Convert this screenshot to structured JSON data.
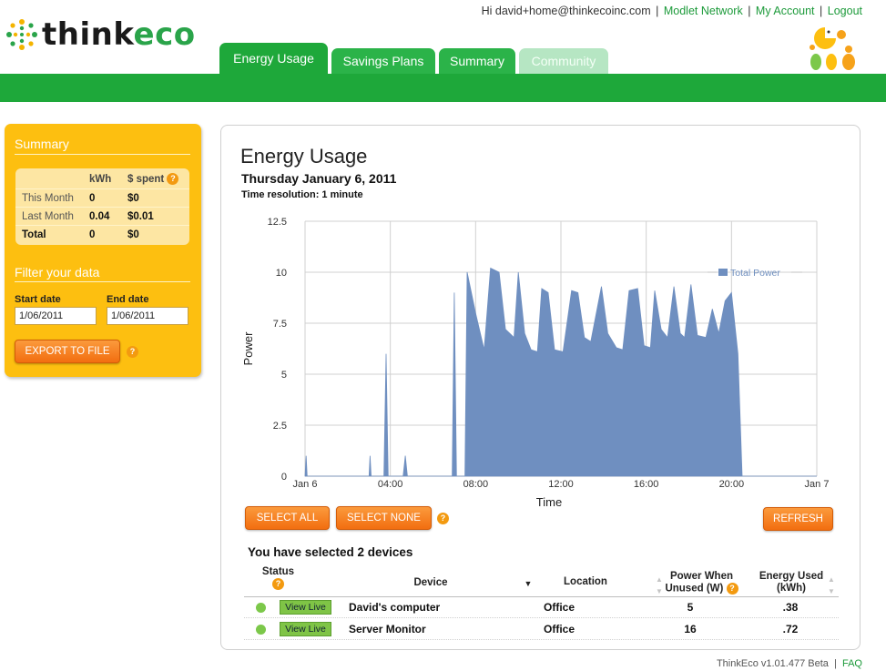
{
  "app": {
    "logo_think": "think",
    "logo_eco": "eco"
  },
  "toplinks": {
    "greeting_prefix": "Hi ",
    "email": "david+home@thinkecoinc.com",
    "separator": "|",
    "modlet_network": "Modlet Network",
    "my_account": "My Account",
    "logout": "Logout"
  },
  "tabs": [
    {
      "label": "Energy Usage",
      "state": "active"
    },
    {
      "label": "Savings Plans",
      "state": "normal"
    },
    {
      "label": "Summary",
      "state": "normal"
    },
    {
      "label": "Community",
      "state": "disabled"
    }
  ],
  "sidebar": {
    "summary_title": "Summary",
    "table": {
      "headers": [
        "",
        "kWh",
        "$ spent"
      ],
      "rows": [
        [
          "This Month",
          "0",
          "$0"
        ],
        [
          "Last Month",
          "0.04",
          "$0.01"
        ],
        [
          "Total",
          "0",
          "$0"
        ]
      ]
    },
    "help_glyph": "?",
    "filter_title": "Filter your data",
    "start_label": "Start date",
    "end_label": "End date",
    "start_value": "1/06/2011",
    "end_value": "1/06/2011",
    "export_label": "EXPORT TO FILE"
  },
  "main": {
    "title": "Energy Usage",
    "date": "Thursday January 6, 2011",
    "resolution": "Time resolution: 1 minute",
    "select_all": "SELECT ALL",
    "select_none": "SELECT NONE",
    "refresh": "REFRESH",
    "selected_text": "You have selected 2 devices"
  },
  "chart_data": {
    "type": "area",
    "xlabel": "Time",
    "ylabel": "Power",
    "ylim": [
      0,
      12.5
    ],
    "yticks": [
      0,
      2.5,
      5,
      7.5,
      10,
      12.5
    ],
    "xlim": [
      0,
      24
    ],
    "xticks": [
      {
        "x": 0,
        "label": "Jan 6"
      },
      {
        "x": 4,
        "label": "04:00"
      },
      {
        "x": 8,
        "label": "08:00"
      },
      {
        "x": 12,
        "label": "12:00"
      },
      {
        "x": 16,
        "label": "16:00"
      },
      {
        "x": 20,
        "label": "20:00"
      },
      {
        "x": 24,
        "label": "Jan 7"
      }
    ],
    "grid": true,
    "legend": "top-right",
    "series": [
      {
        "name": "Total Power",
        "color": "#6f8fc0",
        "points": [
          [
            0,
            0
          ],
          [
            0.05,
            1
          ],
          [
            0.1,
            0
          ],
          [
            3.0,
            0
          ],
          [
            3.05,
            1
          ],
          [
            3.1,
            0
          ],
          [
            3.7,
            0
          ],
          [
            3.8,
            6
          ],
          [
            3.9,
            0
          ],
          [
            4.6,
            0
          ],
          [
            4.7,
            1
          ],
          [
            4.8,
            0
          ],
          [
            6.9,
            0
          ],
          [
            7.0,
            9
          ],
          [
            7.1,
            0
          ],
          [
            7.5,
            0
          ],
          [
            7.6,
            10
          ],
          [
            8.0,
            8
          ],
          [
            8.4,
            6.2
          ],
          [
            8.7,
            10.2
          ],
          [
            9.1,
            10
          ],
          [
            9.4,
            7.2
          ],
          [
            9.8,
            6.8
          ],
          [
            10.0,
            10
          ],
          [
            10.3,
            7.0
          ],
          [
            10.6,
            6.2
          ],
          [
            10.9,
            6.1
          ],
          [
            11.1,
            9.2
          ],
          [
            11.4,
            9.0
          ],
          [
            11.7,
            6.2
          ],
          [
            12.1,
            6.1
          ],
          [
            12.5,
            9.1
          ],
          [
            12.8,
            9.0
          ],
          [
            13.1,
            6.8
          ],
          [
            13.4,
            6.6
          ],
          [
            13.9,
            9.3
          ],
          [
            14.2,
            7.0
          ],
          [
            14.6,
            6.3
          ],
          [
            14.9,
            6.2
          ],
          [
            15.2,
            9.1
          ],
          [
            15.6,
            9.2
          ],
          [
            15.9,
            6.4
          ],
          [
            16.2,
            6.3
          ],
          [
            16.4,
            9.1
          ],
          [
            16.7,
            7.2
          ],
          [
            17.0,
            6.8
          ],
          [
            17.3,
            9.3
          ],
          [
            17.6,
            7.0
          ],
          [
            17.8,
            6.8
          ],
          [
            18.1,
            9.4
          ],
          [
            18.4,
            6.9
          ],
          [
            18.8,
            6.8
          ],
          [
            19.1,
            8.2
          ],
          [
            19.4,
            7.0
          ],
          [
            19.7,
            8.6
          ],
          [
            20.0,
            9.0
          ],
          [
            20.3,
            6.0
          ],
          [
            20.5,
            0
          ],
          [
            24,
            0
          ]
        ]
      }
    ]
  },
  "devices": {
    "headers": {
      "status": "Status",
      "device": "Device",
      "location": "Location",
      "power1": "Power When",
      "power2": "Unused  (W)",
      "energy1": "Energy Used",
      "energy2": "(kWh)"
    },
    "view_live": "View Live",
    "rows": [
      {
        "device": "David's computer",
        "location": "Office",
        "power": "5",
        "energy": ".38"
      },
      {
        "device": "Server Monitor",
        "location": "Office",
        "power": "16",
        "energy": ".72"
      }
    ]
  },
  "footer": {
    "version": "ThinkEco v1.01.477 Beta",
    "sep": "|",
    "faq": "FAQ"
  }
}
